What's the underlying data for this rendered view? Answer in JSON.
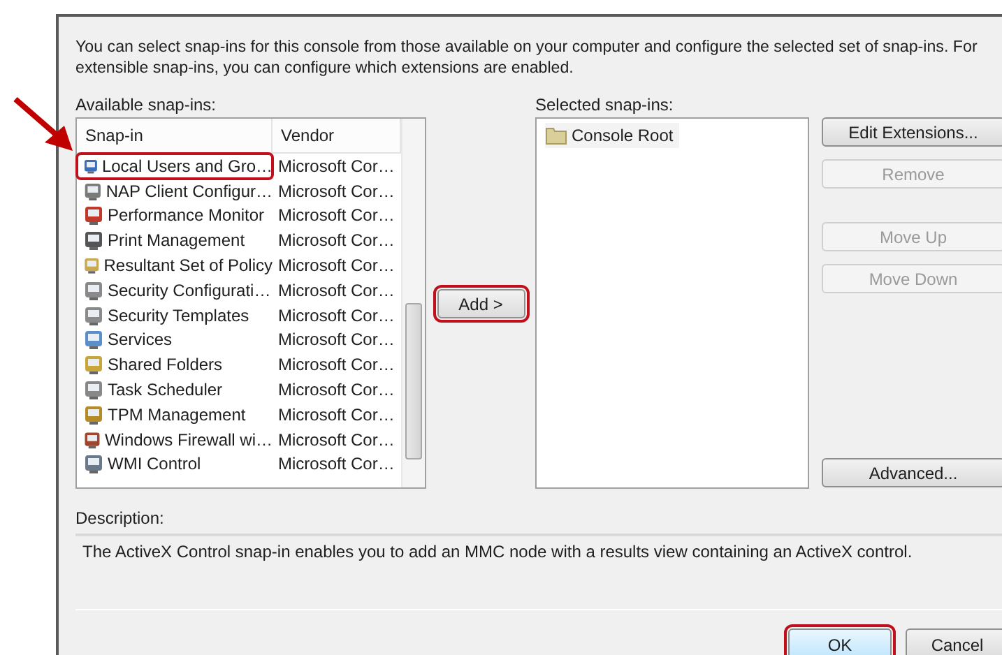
{
  "intro": "You can select snap-ins for this console from those available on your computer and configure the selected set of snap-ins. For extensible snap-ins, you can configure which extensions are enabled.",
  "available": {
    "label": "Available snap-ins:",
    "columns": [
      "Snap-in",
      "Vendor"
    ],
    "rows": [
      {
        "name": "Local Users and Gro…",
        "vendor": "Microsoft Cor…",
        "highlighted": true
      },
      {
        "name": "NAP Client Configur…",
        "vendor": "Microsoft Cor…",
        "highlighted": false
      },
      {
        "name": "Performance Monitor",
        "vendor": "Microsoft Cor…",
        "highlighted": false
      },
      {
        "name": "Print Management",
        "vendor": "Microsoft Cor…",
        "highlighted": false
      },
      {
        "name": "Resultant Set of Policy",
        "vendor": "Microsoft Cor…",
        "highlighted": false
      },
      {
        "name": "Security Configurati…",
        "vendor": "Microsoft Cor…",
        "highlighted": false
      },
      {
        "name": "Security Templates",
        "vendor": "Microsoft Cor…",
        "highlighted": false
      },
      {
        "name": "Services",
        "vendor": "Microsoft Cor…",
        "highlighted": false
      },
      {
        "name": "Shared Folders",
        "vendor": "Microsoft Cor…",
        "highlighted": false
      },
      {
        "name": "Task Scheduler",
        "vendor": "Microsoft Cor…",
        "highlighted": false
      },
      {
        "name": "TPM Management",
        "vendor": "Microsoft Cor…",
        "highlighted": false
      },
      {
        "name": "Windows Firewall wi…",
        "vendor": "Microsoft Cor…",
        "highlighted": false
      },
      {
        "name": "WMI Control",
        "vendor": "Microsoft Cor…",
        "highlighted": false
      }
    ]
  },
  "add_button": {
    "label": "Add >",
    "highlighted": true
  },
  "selected": {
    "label": "Selected snap-ins:",
    "items": [
      "Console Root"
    ]
  },
  "side_buttons": {
    "top": [
      {
        "label": "Edit Extensions...",
        "disabled": false
      },
      {
        "label": "Remove",
        "disabled": true
      }
    ],
    "middle": [
      {
        "label": "Move Up",
        "disabled": true
      },
      {
        "label": "Move Down",
        "disabled": true
      }
    ],
    "bottom": [
      {
        "label": "Advanced...",
        "disabled": false
      }
    ]
  },
  "description": {
    "label": "Description:",
    "text": "The ActiveX Control snap-in enables you to add an MMC node with a results view containing an ActiveX control."
  },
  "footer_buttons": [
    {
      "label": "OK",
      "highlighted": true,
      "default": true
    },
    {
      "label": "Cancel",
      "highlighted": false,
      "default": false
    }
  ]
}
